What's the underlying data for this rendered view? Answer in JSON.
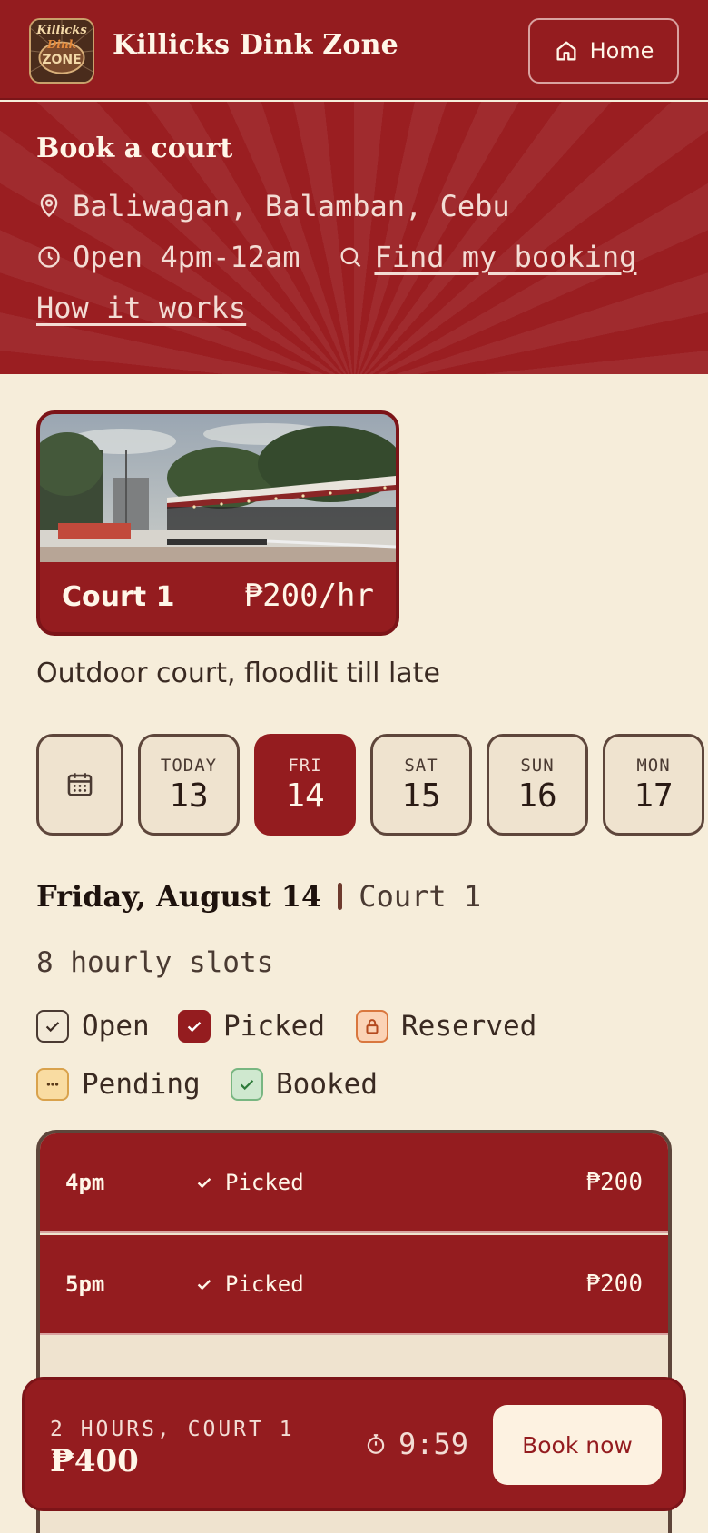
{
  "header": {
    "brand": "Killicks Dink Zone",
    "logo_text": [
      "Killicks",
      "Dink",
      "ZONE"
    ],
    "home_label": "Home",
    "home_icon": "home-icon"
  },
  "hero": {
    "title": "Book a court",
    "location": "Baliwagan, Balamban, Cebu",
    "hours": "Open 4pm-12am",
    "find_booking": "Find my booking",
    "how_it_works": "How it works"
  },
  "court": {
    "name": "Court 1",
    "price": "₱200/hr",
    "description": "Outdoor court, floodlit till late"
  },
  "dates": [
    {
      "dow": "TODAY",
      "day": "13",
      "selected": false
    },
    {
      "dow": "FRI",
      "day": "14",
      "selected": true
    },
    {
      "dow": "SAT",
      "day": "15",
      "selected": false
    },
    {
      "dow": "SUN",
      "day": "16",
      "selected": false
    },
    {
      "dow": "MON",
      "day": "17",
      "selected": false
    }
  ],
  "day_heading": {
    "date": "Friday, August 14",
    "court": "Court 1",
    "slot_count": "8 hourly slots"
  },
  "legend": {
    "open": "Open",
    "picked": "Picked",
    "reserved": "Reserved",
    "pending": "Pending",
    "booked": "Booked"
  },
  "slots": [
    {
      "time": "4pm",
      "status": "Picked",
      "price": "₱200"
    },
    {
      "time": "5pm",
      "status": "Picked",
      "price": "₱200"
    },
    {
      "time": "",
      "status": "",
      "price": "₱"
    }
  ],
  "summary": {
    "label": "2 HOURS, COURT 1",
    "total": "₱400",
    "timer": "9:59",
    "book_label": "Book now"
  },
  "colors": {
    "brand_red": "#941c1f",
    "cream": "#f6edda",
    "chip_bg": "#efe3cf"
  }
}
